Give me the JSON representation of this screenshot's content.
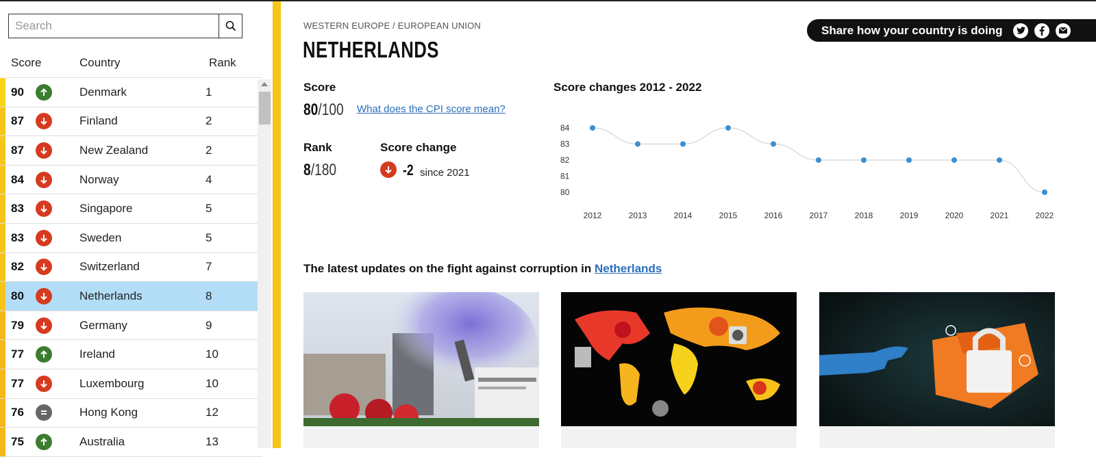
{
  "search": {
    "placeholder": "Search"
  },
  "list": {
    "headers": {
      "score": "Score",
      "country": "Country",
      "rank": "Rank"
    },
    "rows": [
      {
        "score": "90",
        "trend": "up",
        "country": "Denmark",
        "rank": "1",
        "bar": "#f7d417"
      },
      {
        "score": "87",
        "trend": "down",
        "country": "Finland",
        "rank": "2",
        "bar": "#f5c518"
      },
      {
        "score": "87",
        "trend": "down",
        "country": "New Zealand",
        "rank": "2",
        "bar": "#f5c518"
      },
      {
        "score": "84",
        "trend": "down",
        "country": "Norway",
        "rank": "4",
        "bar": "#f5c518"
      },
      {
        "score": "83",
        "trend": "down",
        "country": "Singapore",
        "rank": "5",
        "bar": "#f5c518"
      },
      {
        "score": "83",
        "trend": "down",
        "country": "Sweden",
        "rank": "5",
        "bar": "#f5c518"
      },
      {
        "score": "82",
        "trend": "down",
        "country": "Switzerland",
        "rank": "7",
        "bar": "#f5c518"
      },
      {
        "score": "80",
        "trend": "down",
        "country": "Netherlands",
        "rank": "8",
        "bar": "#f5c518",
        "selected": true
      },
      {
        "score": "79",
        "trend": "down",
        "country": "Germany",
        "rank": "9",
        "bar": "#f5b818"
      },
      {
        "score": "77",
        "trend": "up",
        "country": "Ireland",
        "rank": "10",
        "bar": "#f5b818"
      },
      {
        "score": "77",
        "trend": "down",
        "country": "Luxembourg",
        "rank": "10",
        "bar": "#f5b818"
      },
      {
        "score": "76",
        "trend": "same",
        "country": "Hong Kong",
        "rank": "12",
        "bar": "#f5b818"
      },
      {
        "score": "75",
        "trend": "up",
        "country": "Australia",
        "rank": "13",
        "bar": "#f5b818"
      }
    ]
  },
  "country": {
    "breadcrumb": "WESTERN EUROPE / EUROPEAN UNION",
    "name": "NETHERLANDS",
    "score_label": "Score",
    "score": "80",
    "score_max": "/100",
    "cpi_link": "What does the CPI score mean?",
    "rank_label": "Rank",
    "rank": "8",
    "rank_total": "/180",
    "change_label": "Score change",
    "change": "-2",
    "since": "since 2021"
  },
  "share": {
    "label": "Share how your country is doing",
    "icons": [
      "twitter-icon",
      "facebook-icon",
      "email-icon"
    ]
  },
  "chart_data": {
    "type": "line",
    "title": "Score changes 2012 - 2022",
    "x": [
      "2012",
      "2013",
      "2014",
      "2015",
      "2016",
      "2017",
      "2018",
      "2019",
      "2020",
      "2021",
      "2022"
    ],
    "values": [
      84,
      83,
      83,
      84,
      83,
      82,
      82,
      82,
      82,
      82,
      80
    ],
    "yticks": [
      "84",
      "83",
      "82",
      "81",
      "80"
    ],
    "ylim": [
      80,
      84
    ],
    "color": "#3b8fd1",
    "grid": false
  },
  "updates": {
    "title_prefix": "The latest updates on the fight against corruption in ",
    "title_link": "Netherlands"
  },
  "colors": {
    "up": "#3a7d2f",
    "down": "#d63a1f",
    "same": "#666666",
    "accent": "#f5c518",
    "selected": "#b3ddf7"
  }
}
